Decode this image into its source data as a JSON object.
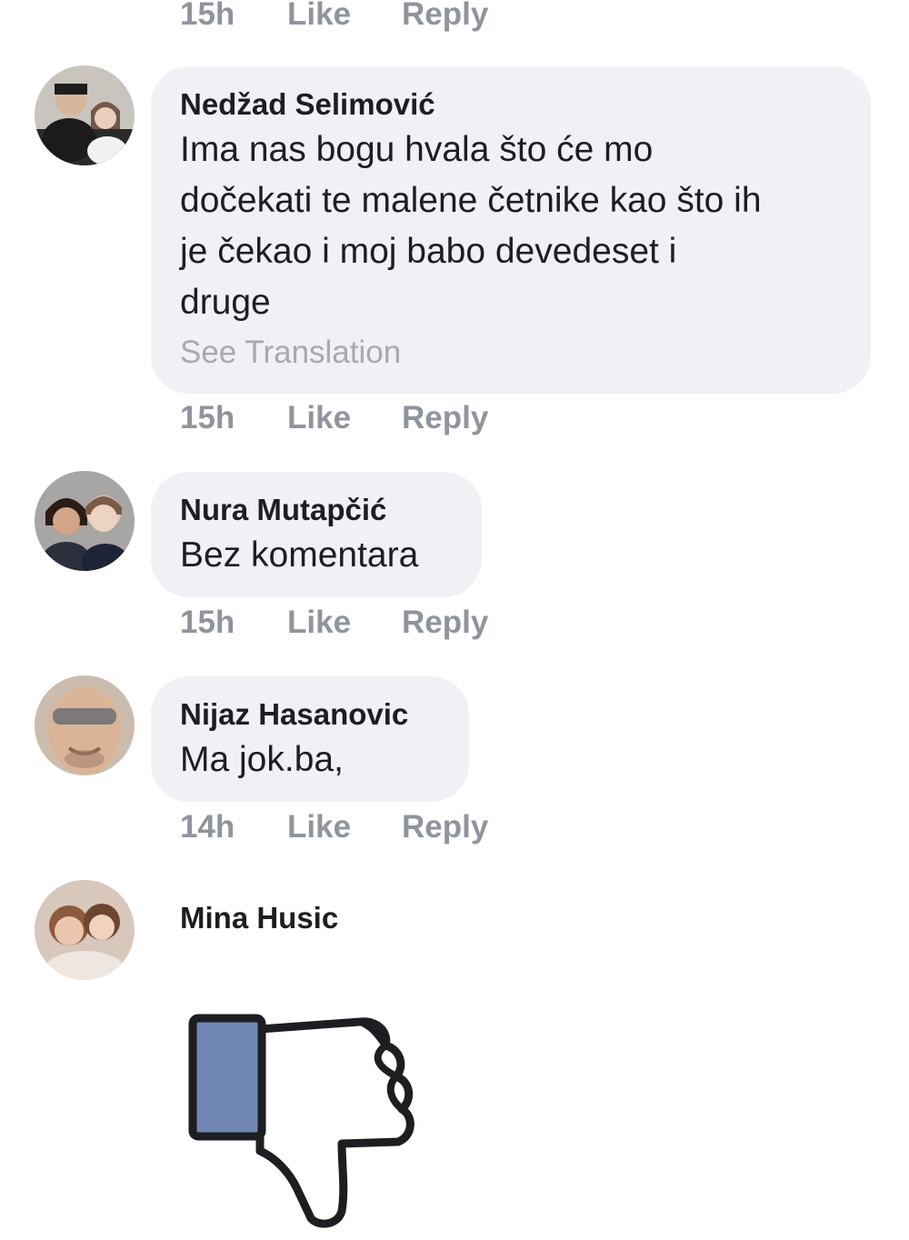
{
  "top_meta": {
    "time": "15h",
    "like": "Like",
    "reply": "Reply"
  },
  "comments": [
    {
      "name": "Nedžad Selimović",
      "text": "Ima nas bogu hvala što će mo\ndočekati te malene četnike kao što ih\nje čekao i moj babo devedeset i\ndruge",
      "see_translation": "See Translation",
      "time": "15h",
      "like": "Like",
      "reply": "Reply"
    },
    {
      "name": "Nura Mutapčić",
      "text": "Bez komentara",
      "time": "15h",
      "like": "Like",
      "reply": "Reply"
    },
    {
      "name": "Nijaz Hasanovic",
      "text": "Ma jok.ba,",
      "time": "14h",
      "like": "Like",
      "reply": "Reply"
    },
    {
      "name": "Mina Husic",
      "sticker": "thumbs-down-icon"
    }
  ],
  "colors": {
    "bubble": "#f0f1f4",
    "meta_text": "#90949c",
    "thumb_cuff": "#6f86b5"
  }
}
